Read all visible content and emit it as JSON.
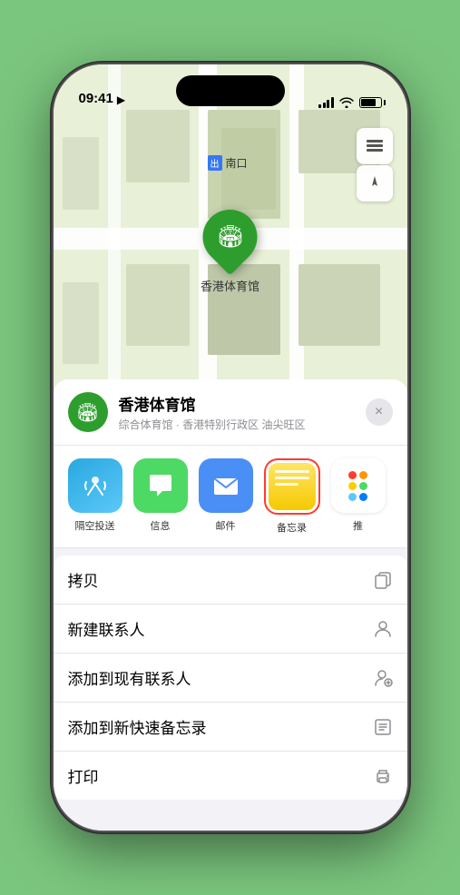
{
  "statusBar": {
    "time": "09:41",
    "locationIcon": "▶"
  },
  "map": {
    "landmark": "香港体育馆",
    "nankouLabel": "南口",
    "nankouBadge": "出口"
  },
  "mapButtons": {
    "layers": "🗺",
    "location": "⟴"
  },
  "locationCard": {
    "name": "香港体育馆",
    "subtitle": "综合体育馆 · 香港特别行政区 油尖旺区",
    "closeLabel": "×"
  },
  "shareItems": [
    {
      "id": "airdrop",
      "label": "隔空投送"
    },
    {
      "id": "message",
      "label": "信息"
    },
    {
      "id": "mail",
      "label": "邮件"
    },
    {
      "id": "notes",
      "label": "备忘录"
    },
    {
      "id": "more",
      "label": "推"
    }
  ],
  "actionItems": [
    {
      "label": "拷贝",
      "icon": "copy"
    },
    {
      "label": "新建联系人",
      "icon": "person"
    },
    {
      "label": "添加到现有联系人",
      "icon": "person-add"
    },
    {
      "label": "添加到新快速备忘录",
      "icon": "note"
    },
    {
      "label": "打印",
      "icon": "printer"
    }
  ],
  "colors": {
    "green": "#2d9e2d",
    "blue": "#4a8ff5",
    "red": "#ff3b30",
    "dots": [
      "#ff3b30",
      "#ff9500",
      "#ffcc00",
      "#4cd964",
      "#5ac8fa",
      "#007aff"
    ]
  }
}
